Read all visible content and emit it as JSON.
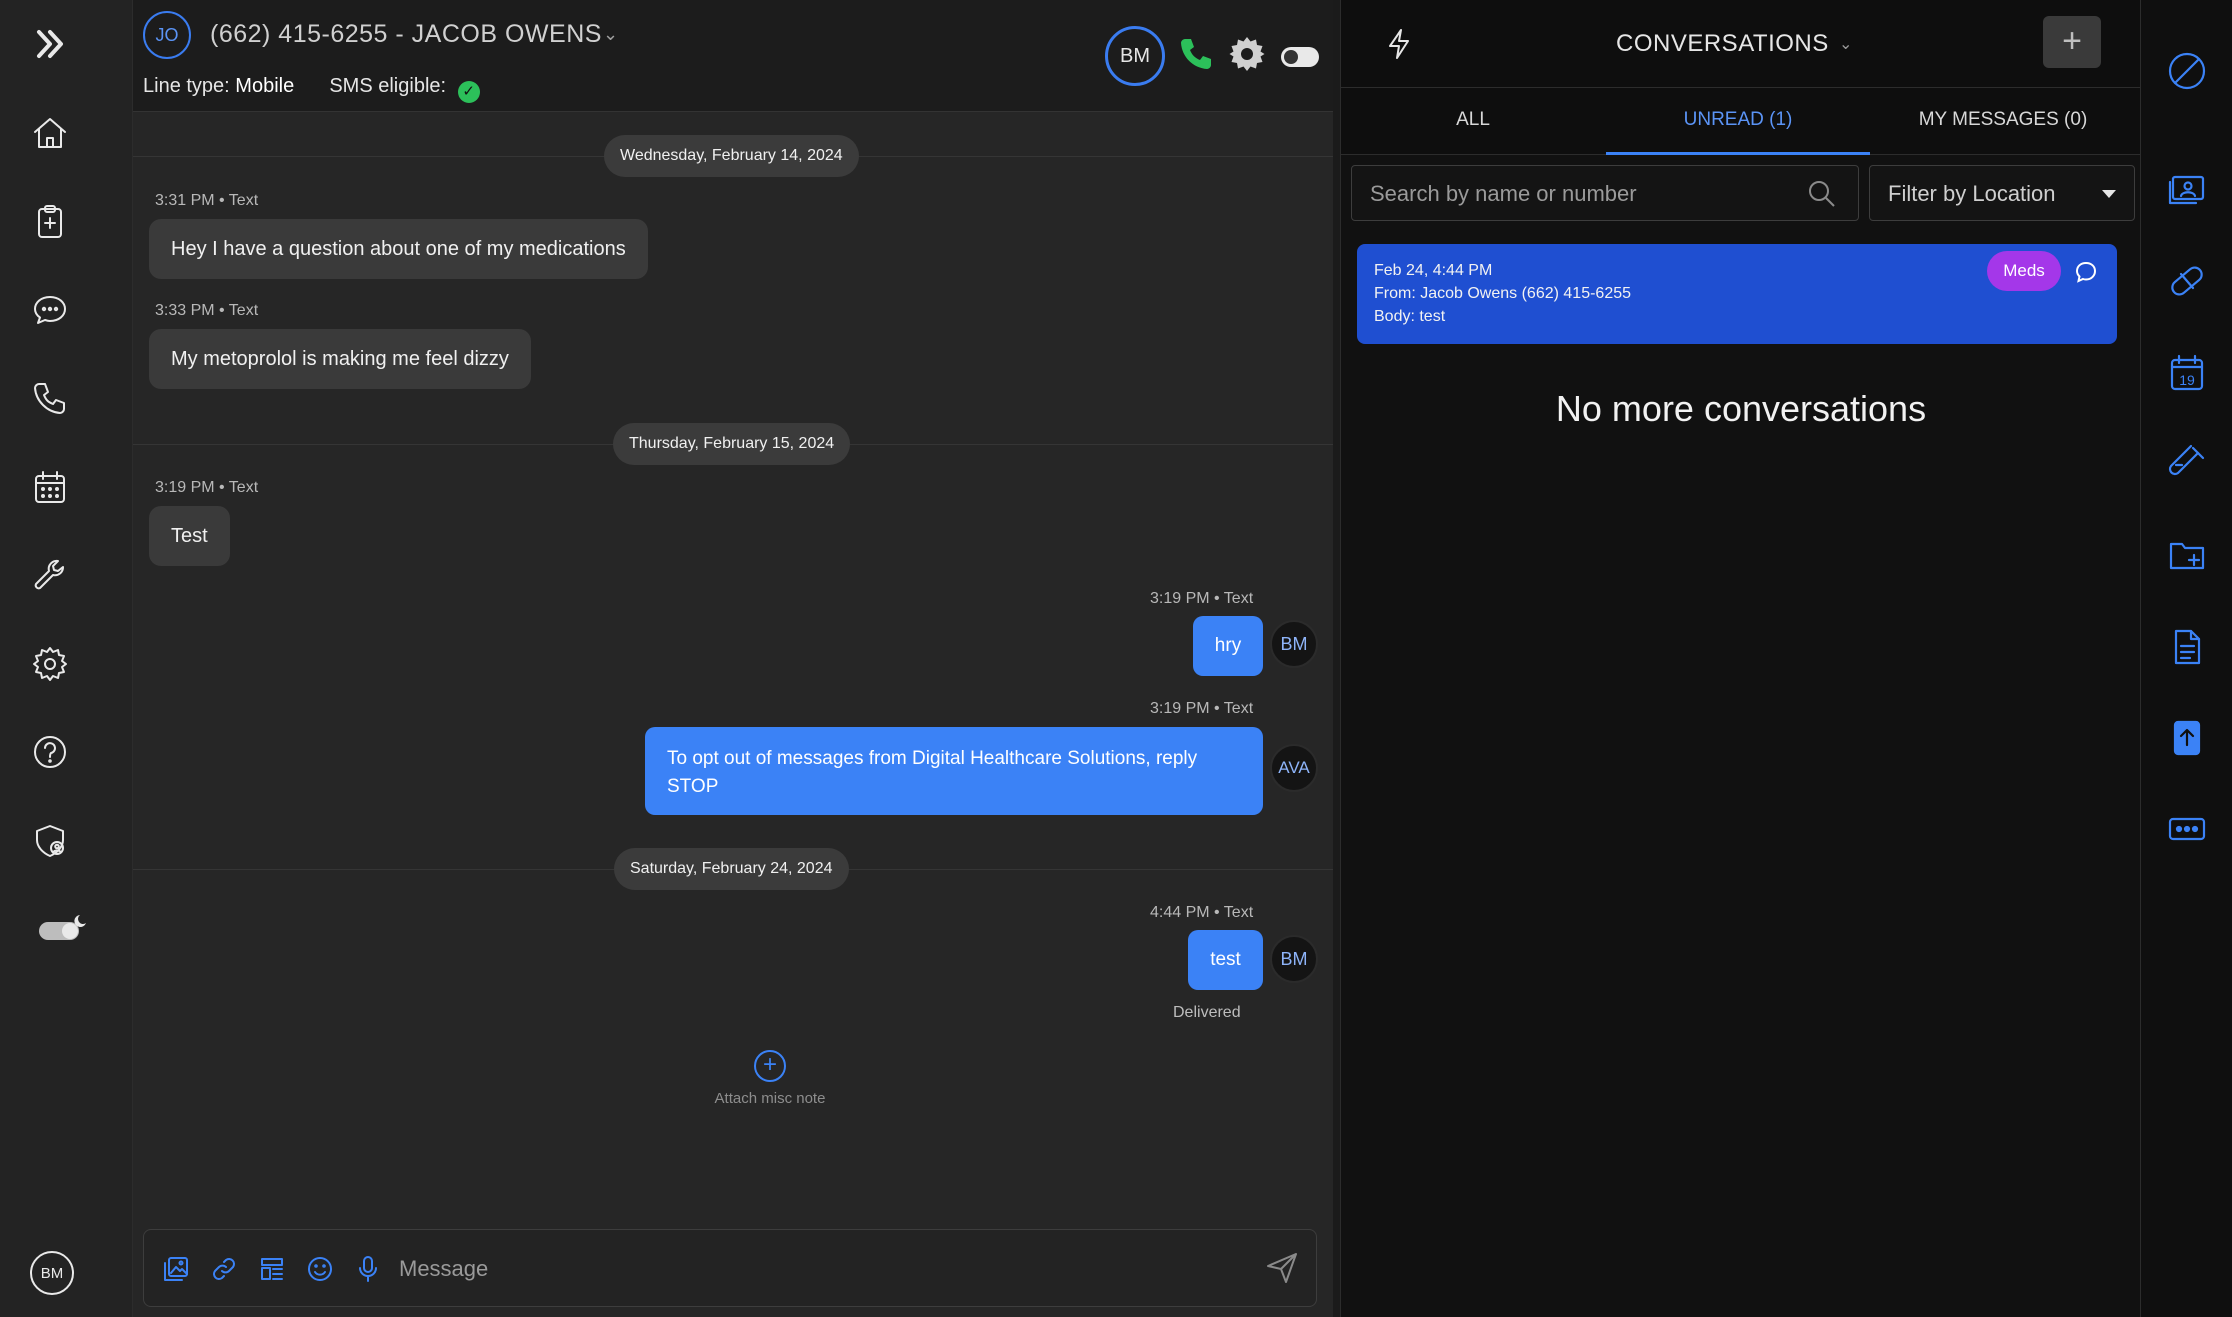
{
  "left_nav": {
    "items": [
      {
        "name": "expand-icon"
      },
      {
        "name": "home-icon"
      },
      {
        "name": "clipboard-icon"
      },
      {
        "name": "chat-icon"
      },
      {
        "name": "phone-icon"
      },
      {
        "name": "calendar-icon"
      },
      {
        "name": "wrench-icon"
      },
      {
        "name": "gear-icon"
      },
      {
        "name": "help-icon"
      },
      {
        "name": "shield-user-icon"
      },
      {
        "name": "dark-mode-toggle-icon"
      }
    ],
    "user_initials": "BM"
  },
  "chat": {
    "contact_initials": "JO",
    "title": "(662) 415-6255 - JACOB OWENS",
    "line_type_label": "Line type:",
    "line_type_value": "Mobile",
    "sms_label": "SMS eligible:",
    "agent_initials": "BM",
    "dates": [
      "Wednesday, February 14, 2024",
      "Thursday, February 15, 2024",
      "Saturday, February 24, 2024"
    ],
    "messages": [
      {
        "meta": "3:31 PM • Text",
        "text": "Hey I have a question about one of my medications",
        "direction": "in"
      },
      {
        "meta": "3:33 PM • Text",
        "text": "My metoprolol is making me feel dizzy",
        "direction": "in"
      },
      {
        "meta": "3:19 PM • Text",
        "text": "Test",
        "direction": "in"
      },
      {
        "meta": "3:19 PM • Text",
        "text": "hry",
        "direction": "out",
        "avatar": "BM"
      },
      {
        "meta": "3:19 PM • Text",
        "text": "To opt out of messages from Digital Healthcare Solutions, reply STOP",
        "direction": "out",
        "avatar": "AVA"
      },
      {
        "meta": "4:44 PM • Text",
        "text": "test",
        "direction": "out",
        "avatar": "BM"
      }
    ],
    "delivered": "Delivered",
    "attach_label": "Attach misc note",
    "composer_placeholder": "Message"
  },
  "conversations": {
    "title": "CONVERSATIONS",
    "tabs": [
      {
        "label": "ALL"
      },
      {
        "label": "UNREAD (1)"
      },
      {
        "label": "MY MESSAGES (0)"
      }
    ],
    "active_tab": "UNREAD (1)",
    "search_placeholder": "Search by name or number",
    "filter_label": "Filter by Location",
    "card": {
      "date": "Feb 24, 4:44 PM",
      "from": "From: Jacob Owens (662) 415-6255",
      "body": "Body: test",
      "tag": "Meds"
    },
    "empty_text": "No more conversations"
  },
  "right_rail": {
    "items": [
      {
        "name": "block-icon"
      },
      {
        "name": "screen-user-icon"
      },
      {
        "name": "pill-icon"
      },
      {
        "name": "calendar-19-icon"
      },
      {
        "name": "test-tube-icon"
      },
      {
        "name": "folder-add-icon"
      },
      {
        "name": "document-icon"
      },
      {
        "name": "upload-icon"
      },
      {
        "name": "more-icon"
      }
    ],
    "calendar_day": "19"
  },
  "colors": {
    "accent": "#3b82f6",
    "tag": "#a437e9",
    "success": "#2cc05a",
    "card": "#1f4fd1"
  }
}
